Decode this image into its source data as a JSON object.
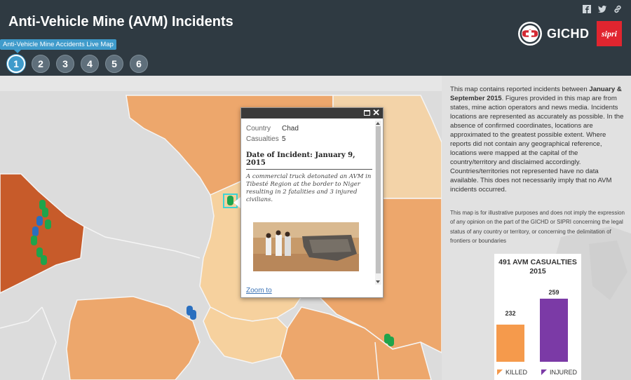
{
  "header": {
    "title": "Anti-Vehicle Mine (AVM) Incidents",
    "logo_gichd": "GICHD",
    "logo_sipri": "sipri",
    "share_icons": [
      "facebook-icon",
      "twitter-icon",
      "link-icon"
    ]
  },
  "tabs": {
    "tooltip": "Anti-Vehicle Mine Accidents Live Map",
    "items": [
      "1",
      "2",
      "3",
      "4",
      "5",
      "6"
    ],
    "active_index": 0
  },
  "popup": {
    "fields": [
      {
        "label": "Country",
        "value": "Chad"
      },
      {
        "label": "Casualties",
        "value": "5"
      }
    ],
    "date": "Date of Incident: January 9, 2015",
    "description": "A commercial truck detonated an AVM in Tibesté Region at the border to Niger resulting in 2 fatalities and 3 injured civilians.",
    "zoom_link": "Zoom to"
  },
  "panel": {
    "intro_part1": "This map contains reported incidents between ",
    "intro_bold": "January & September 2015",
    "intro_part2": ". Figures provided in this map are from states, mine action operators and news media. Incidents locations are represented as accurately as possible. In the absence of confirmed coordinates, locations are approximated to the greatest possible extent. Where reports did not contain any geographical reference, locations were mapped at the capital of the country/territory and disclaimed accordingly. Countries/territories not represented have no data available. This does not necessarily imply that no AVM incidents occurred.",
    "disclaimer": "This map is for illustrative purposes and does not imply the expression of any opinion on the part of the GICHD or SIPRI concerning the legal status of any country or territory, or concerning the delimitation of frontiers or boundaries"
  },
  "casualties": {
    "title_line1": "491 AVM CASUALTIES",
    "title_line2": "2015",
    "killed_label": "KILLED",
    "killed_value": "232",
    "injured_label": "INJURED",
    "injured_value": "259",
    "colors": {
      "killed": "#f59a4c",
      "injured": "#7b3aa6"
    }
  },
  "colors": {
    "header_bg": "#2f3a42",
    "accent": "#3f9bcb"
  }
}
